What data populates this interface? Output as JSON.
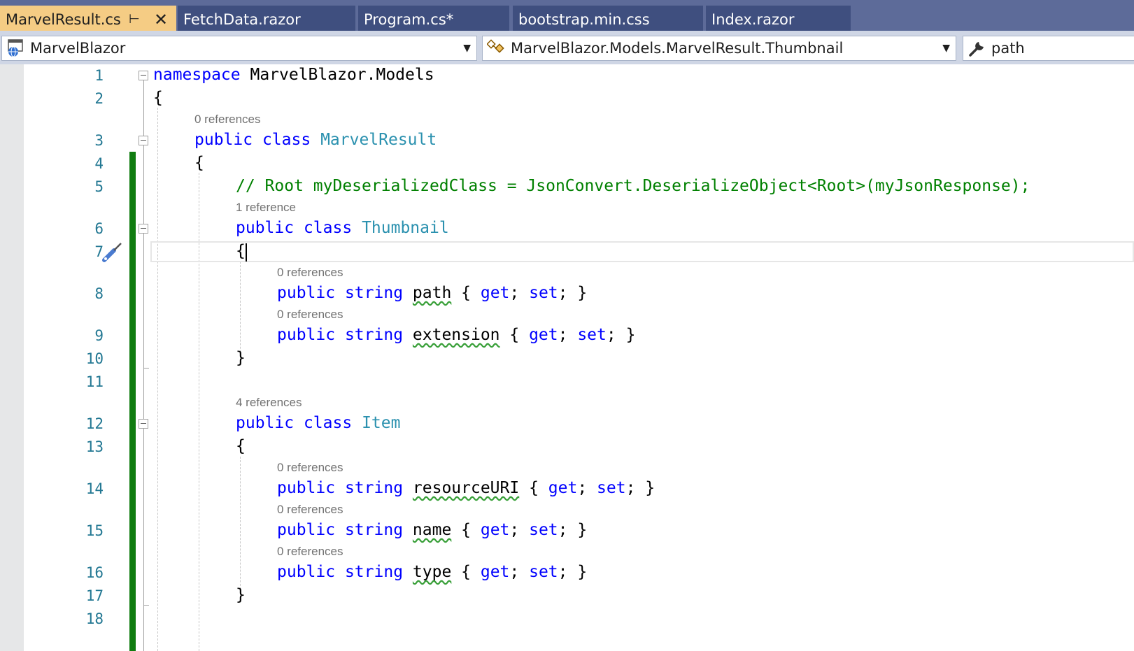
{
  "tabs": [
    {
      "label": "MarvelResult.cs",
      "active": true
    },
    {
      "label": "FetchData.razor",
      "active": false
    },
    {
      "label": "Program.cs*",
      "active": false
    },
    {
      "label": "bootstrap.min.css",
      "active": false
    },
    {
      "label": "Index.razor",
      "active": false
    }
  ],
  "tab_icons": {
    "pin": "pin-icon",
    "close": "close-icon"
  },
  "navbar": {
    "project": "MarvelBlazor",
    "type": "MarvelBlazor.Models.MarvelResult.Thumbnail",
    "member": "path"
  },
  "line_numbers": [
    "1",
    "2",
    "3",
    "4",
    "5",
    "6",
    "7",
    "8",
    "9",
    "10",
    "11",
    "12",
    "13",
    "14",
    "15",
    "16",
    "17",
    "18"
  ],
  "code_lens": {
    "l3": "0 references",
    "l6": "1 reference",
    "l8": "0 references",
    "l9": "0 references",
    "l12": "4 references",
    "l14": "0 references",
    "l15": "0 references",
    "l16": "0 references"
  },
  "code": {
    "kw_namespace": "namespace",
    "ns_name": " MarvelBlazor.Models",
    "brace_open": "{",
    "brace_close": "}",
    "kw_public": "public",
    "kw_class": "class",
    "kw_string": "string",
    "kw_get": "get",
    "kw_set": "set",
    "class_marvelresult": "MarvelResult",
    "comment": "// Root myDeserializedClass = JsonConvert.DeserializeObject<Root>(myJsonResponse);",
    "class_thumbnail": "Thumbnail",
    "prop_path": "path",
    "prop_extension": "extension",
    "class_item": "Item",
    "prop_resourceuri": "resourceURI",
    "prop_name": "name",
    "prop_type": "type"
  },
  "colors": {
    "keyword": "#0000ff",
    "type": "#2b91af",
    "comment": "#008000",
    "linenumber": "#237893",
    "changebar": "#107c10",
    "active_tab": "#f5cc84"
  }
}
